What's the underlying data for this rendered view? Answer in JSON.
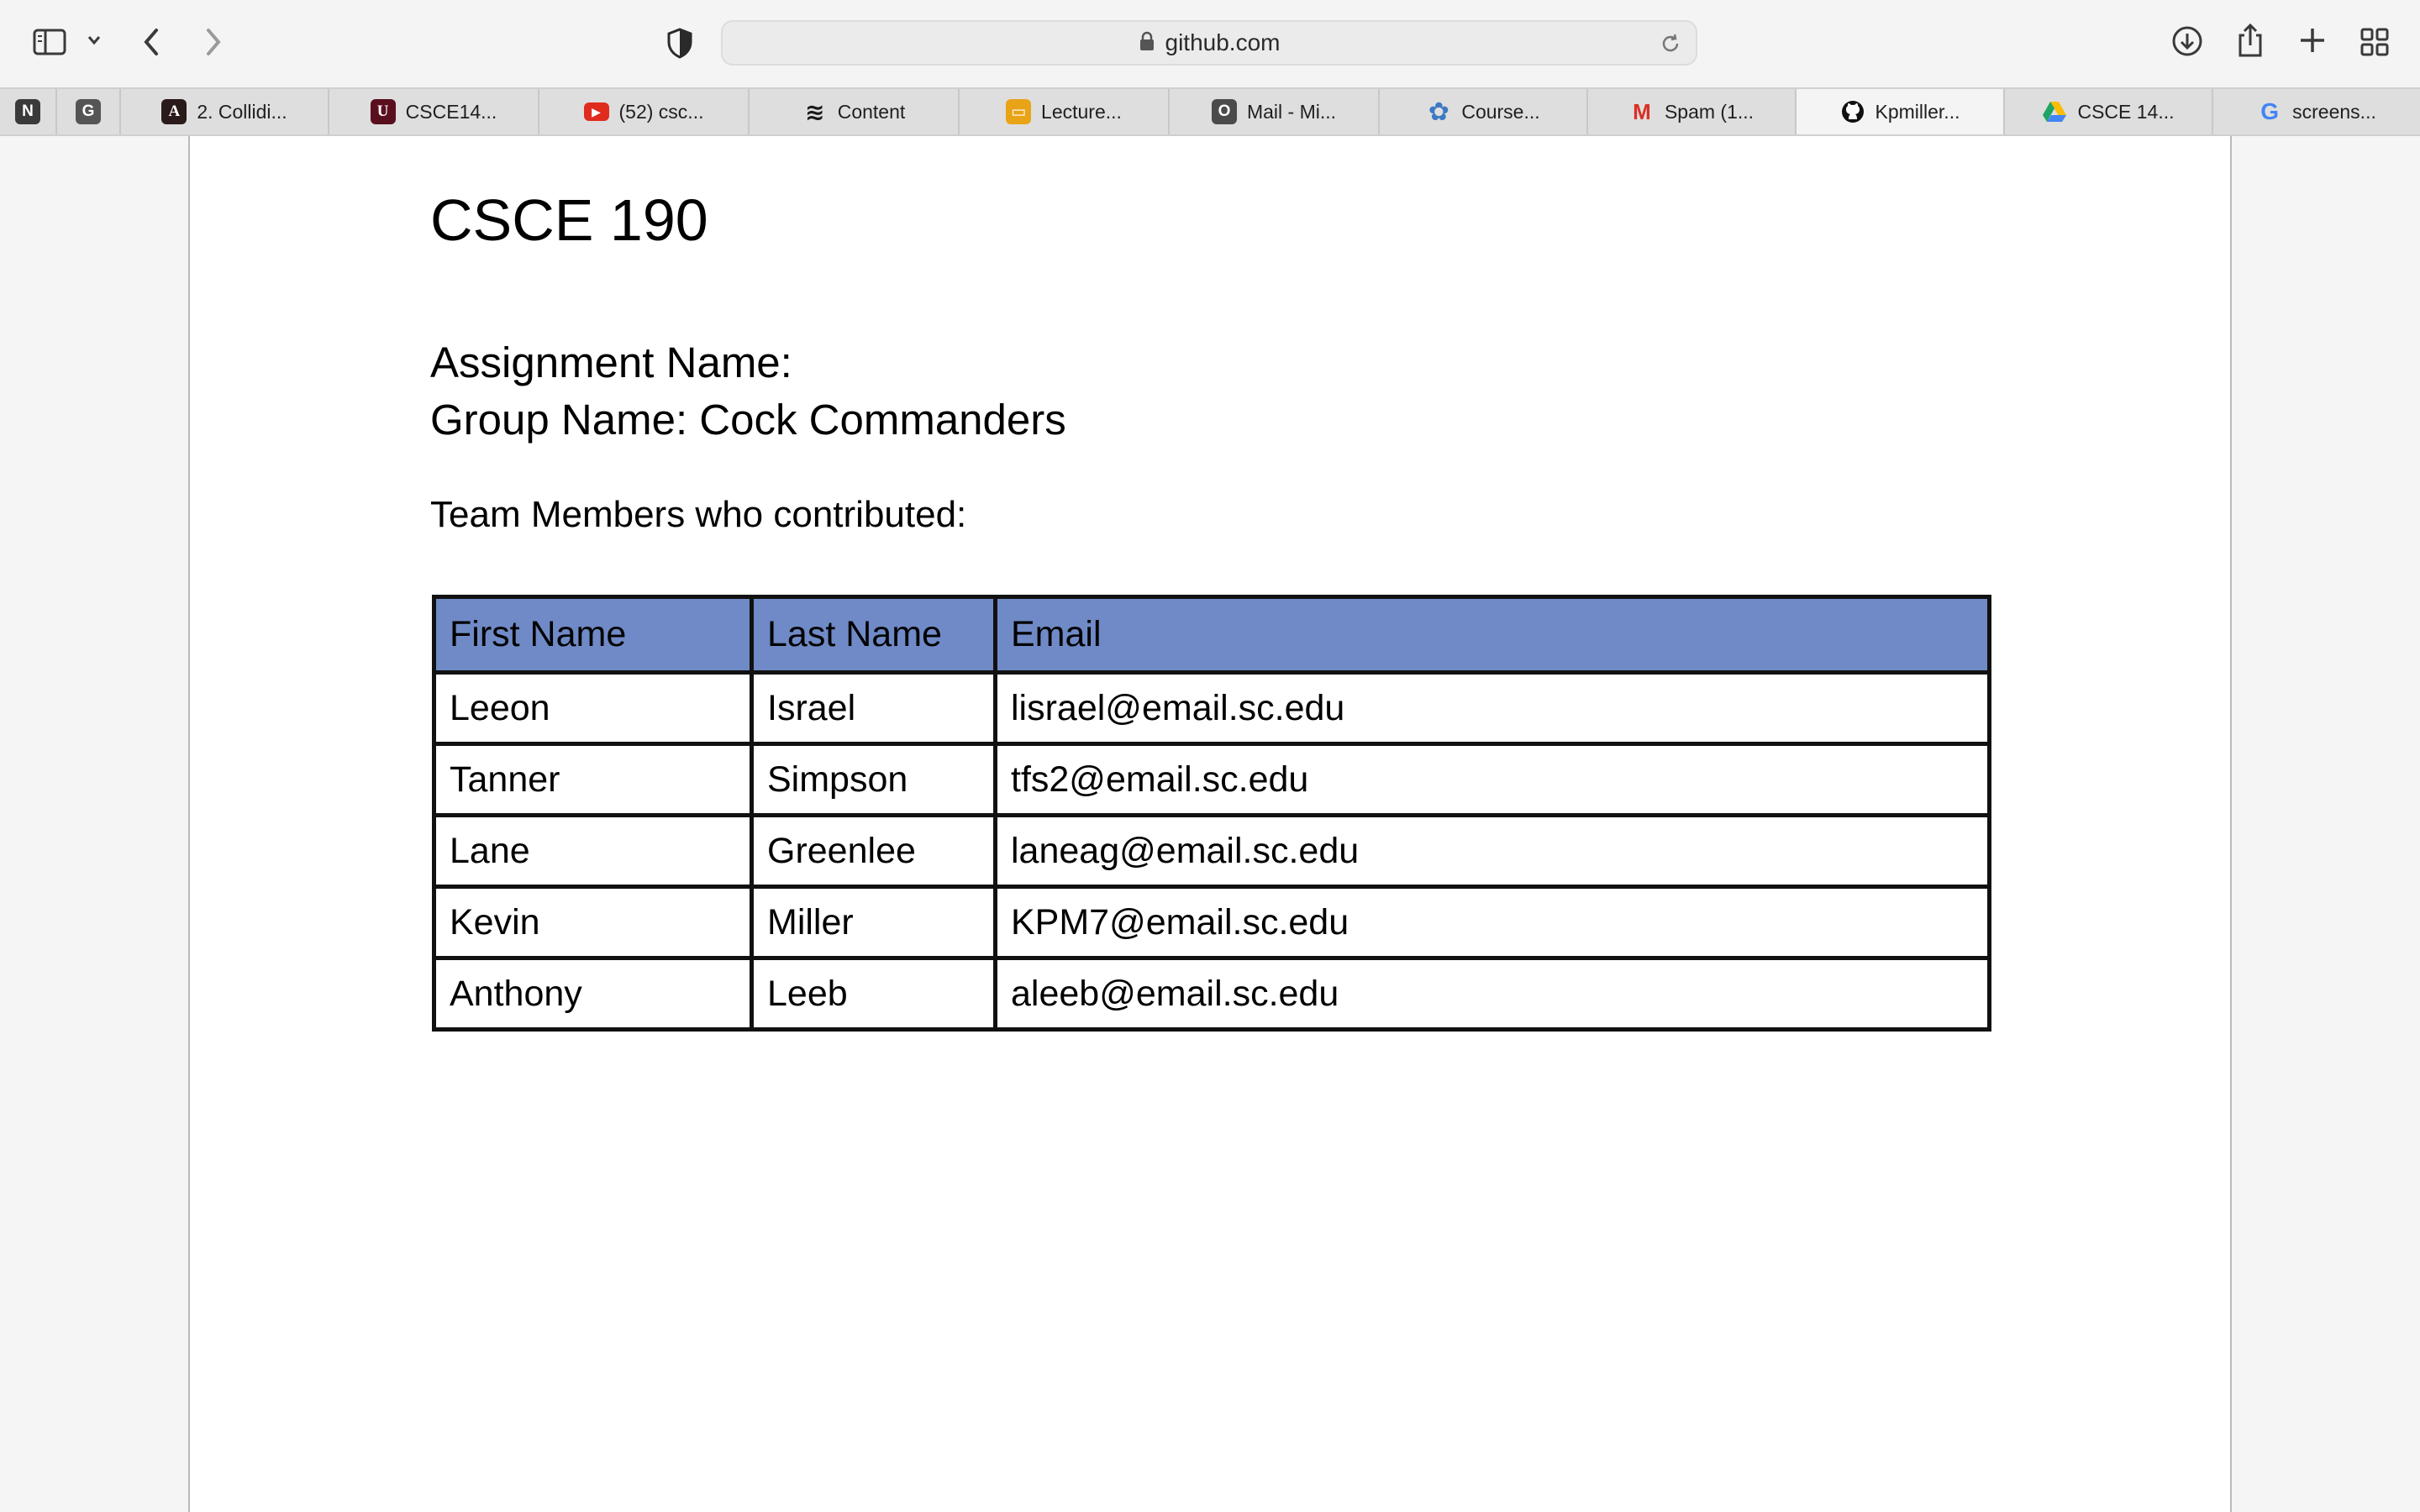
{
  "browser": {
    "url": "github.com",
    "tabs": [
      {
        "label": "",
        "icon": "notion-icon",
        "glyph": "N",
        "color": "#3a3a3a"
      },
      {
        "label": "",
        "icon": "gradescope-icon",
        "glyph": "G",
        "color": "#555555"
      },
      {
        "label": "2. Collidi...",
        "icon": "book-icon",
        "glyph": "A",
        "color": "#2b1a1a"
      },
      {
        "label": "CSCE14...",
        "icon": "usc-icon",
        "glyph": "U",
        "color": "#5a0f1e"
      },
      {
        "label": "(52) csc...",
        "icon": "youtube-icon",
        "glyph": "▶",
        "color": "#e02b1f"
      },
      {
        "label": "Content",
        "icon": "content-icon",
        "glyph": "≋",
        "color": "#1a1a1a"
      },
      {
        "label": "Lecture...",
        "icon": "slides-icon",
        "glyph": "▭",
        "color": "#e8a317"
      },
      {
        "label": "Mail - Mi...",
        "icon": "outlook-icon",
        "glyph": "O",
        "color": "#4b4b4b"
      },
      {
        "label": "Course...",
        "icon": "course-icon",
        "glyph": "✿",
        "color": "#3b79c4"
      },
      {
        "label": "Spam (1...",
        "icon": "gmail-icon",
        "glyph": "M",
        "color": "#d93025"
      },
      {
        "label": "Kpmiller...",
        "icon": "github-icon",
        "glyph": "●",
        "color": "#111111",
        "active": true
      },
      {
        "label": "CSCE 14...",
        "icon": "google-drive-icon",
        "glyph": "▲",
        "color": "#1fa463"
      },
      {
        "label": "screens...",
        "icon": "google-icon",
        "glyph": "G",
        "color": "#4285f4"
      }
    ]
  },
  "doc": {
    "title": "CSCE 190",
    "assignment_label": "Assignment Name:",
    "group_label": "Group Name: Cock Commanders",
    "team_label": "Team Members who contributed:",
    "table": {
      "headers": [
        "First Name",
        "Last Name",
        "Email"
      ],
      "rows": [
        [
          "Leeon",
          "Israel",
          "lisrael@email.sc.edu"
        ],
        [
          "Tanner",
          "Simpson",
          "tfs2@email.sc.edu"
        ],
        [
          "Lane",
          "Greenlee",
          "laneag@email.sc.edu"
        ],
        [
          "Kevin",
          "Miller",
          "KPM7@email.sc.edu"
        ],
        [
          "Anthony",
          "Leeb",
          "aleeb@email.sc.edu"
        ]
      ],
      "header_color": "#6f8ac6"
    }
  }
}
